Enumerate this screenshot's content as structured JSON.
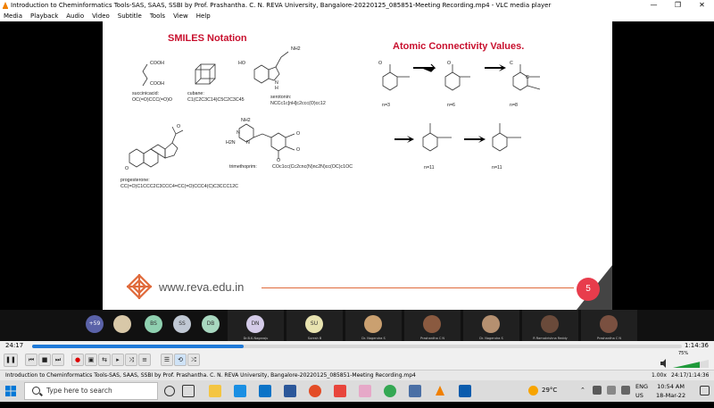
{
  "window": {
    "title": "Introduction to Cheminformatics Tools-SAS, SAAS, SSBI by Prof. Prashantha. C. N. REVA University, Bangalore-20220125_085851-Meeting Recording.mp4 - VLC media player",
    "minimize": "—",
    "maximize": "❐",
    "close": "✕"
  },
  "menu": [
    "Media",
    "Playback",
    "Audio",
    "Video",
    "Subtitle",
    "Tools",
    "View",
    "Help"
  ],
  "slide": {
    "left_title": "SMILES Notation",
    "right_title": "Atomic Connectivity Values.",
    "molecules": [
      {
        "name": "succinicacid:",
        "smiles": "OC(=O)CCC(=O)O",
        "labels": [
          "COOH",
          "COOH"
        ]
      },
      {
        "name": "cubane:",
        "smiles": "C1(C2C3C14)C5C2C3C45"
      },
      {
        "name": "serotonin:",
        "smiles": "NCCc1c[nH]c2ccc(O)cc12",
        "labels": [
          "HO",
          "NH2",
          "N",
          "H"
        ]
      },
      {
        "name": "progesterone:",
        "smiles": "CC(=O)C1CCC2C3CCC4=CC(=O)CCC4(C)C3CCC12C",
        "labels": [
          "O",
          "O"
        ]
      },
      {
        "name": "trimethoprim:",
        "smiles": "COc1cc(Cc2cnc(N)nc2N)cc(OC)c1OC",
        "labels": [
          "NH2",
          "N",
          "N",
          "H2N",
          "O",
          "O",
          "O"
        ]
      }
    ],
    "connectivity": {
      "row1": [
        "n=3",
        "n=6",
        "n=8"
      ],
      "row2": [
        "n=11",
        "n=11"
      ],
      "atoms": [
        "O",
        "O",
        "C",
        "C"
      ]
    },
    "footer_url": "www.reva.edu.in",
    "page_number": "5"
  },
  "participants": {
    "more_count": "+59",
    "circles": [
      {
        "initials": "BS",
        "color": "#8fd0b0"
      },
      {
        "initials": "SS",
        "color": "#c0c8d4"
      },
      {
        "initials": "DB",
        "color": "#a8d8c0"
      }
    ],
    "tiles": [
      {
        "initials": "DN",
        "name": "Dr.B.K.Nagaraju",
        "color": "#d4cbe8",
        "photo": false
      },
      {
        "initials": "SU",
        "name": "Suresh B",
        "color": "#e8e3b0",
        "photo": false
      },
      {
        "initials": "",
        "name": "Dr. Nagendra S",
        "color": "#caa070",
        "photo": true
      },
      {
        "initials": "",
        "name": "Prashantha C N",
        "color": "#8a5a40",
        "photo": true
      },
      {
        "initials": "",
        "name": "Dr. Nagendra S",
        "color": "#b59070",
        "photo": true
      },
      {
        "initials": "",
        "name": "R Ramakrishna Reddy",
        "color": "#6a4a3a",
        "photo": true
      },
      {
        "initials": "",
        "name": "Prashantha C N",
        "color": "#7a5040",
        "photo": true
      }
    ]
  },
  "player": {
    "elapsed": "24:17",
    "total": "1:14:36",
    "progress": 0.325,
    "volume": "75%",
    "volume_level": 0.75,
    "speed": "1.00x",
    "time_ratio": "24:17/1:14:36",
    "filename": "Introduction to Cheminformatics Tools-SAS, SAAS, SSBI by Prof. Prashantha. C. N. REVA University, Bangalore-20220125_085851-Meeting Recording.mp4",
    "buttons": [
      "pause",
      "prev",
      "stop",
      "next",
      "record",
      "snapshot",
      "loop-ab",
      "frame",
      "random",
      "playlist",
      "extended",
      "loop",
      "shuffle"
    ]
  },
  "taskbar": {
    "search_placeholder": "Type here to search",
    "weather": "29°C",
    "lang": "ENG",
    "region": "US",
    "time": "10:54 AM",
    "date": "18-Mar-22"
  },
  "colors": {
    "accent": "#1f7ad8",
    "slide_title": "#c8102e",
    "page_badge": "#e83c4c"
  }
}
